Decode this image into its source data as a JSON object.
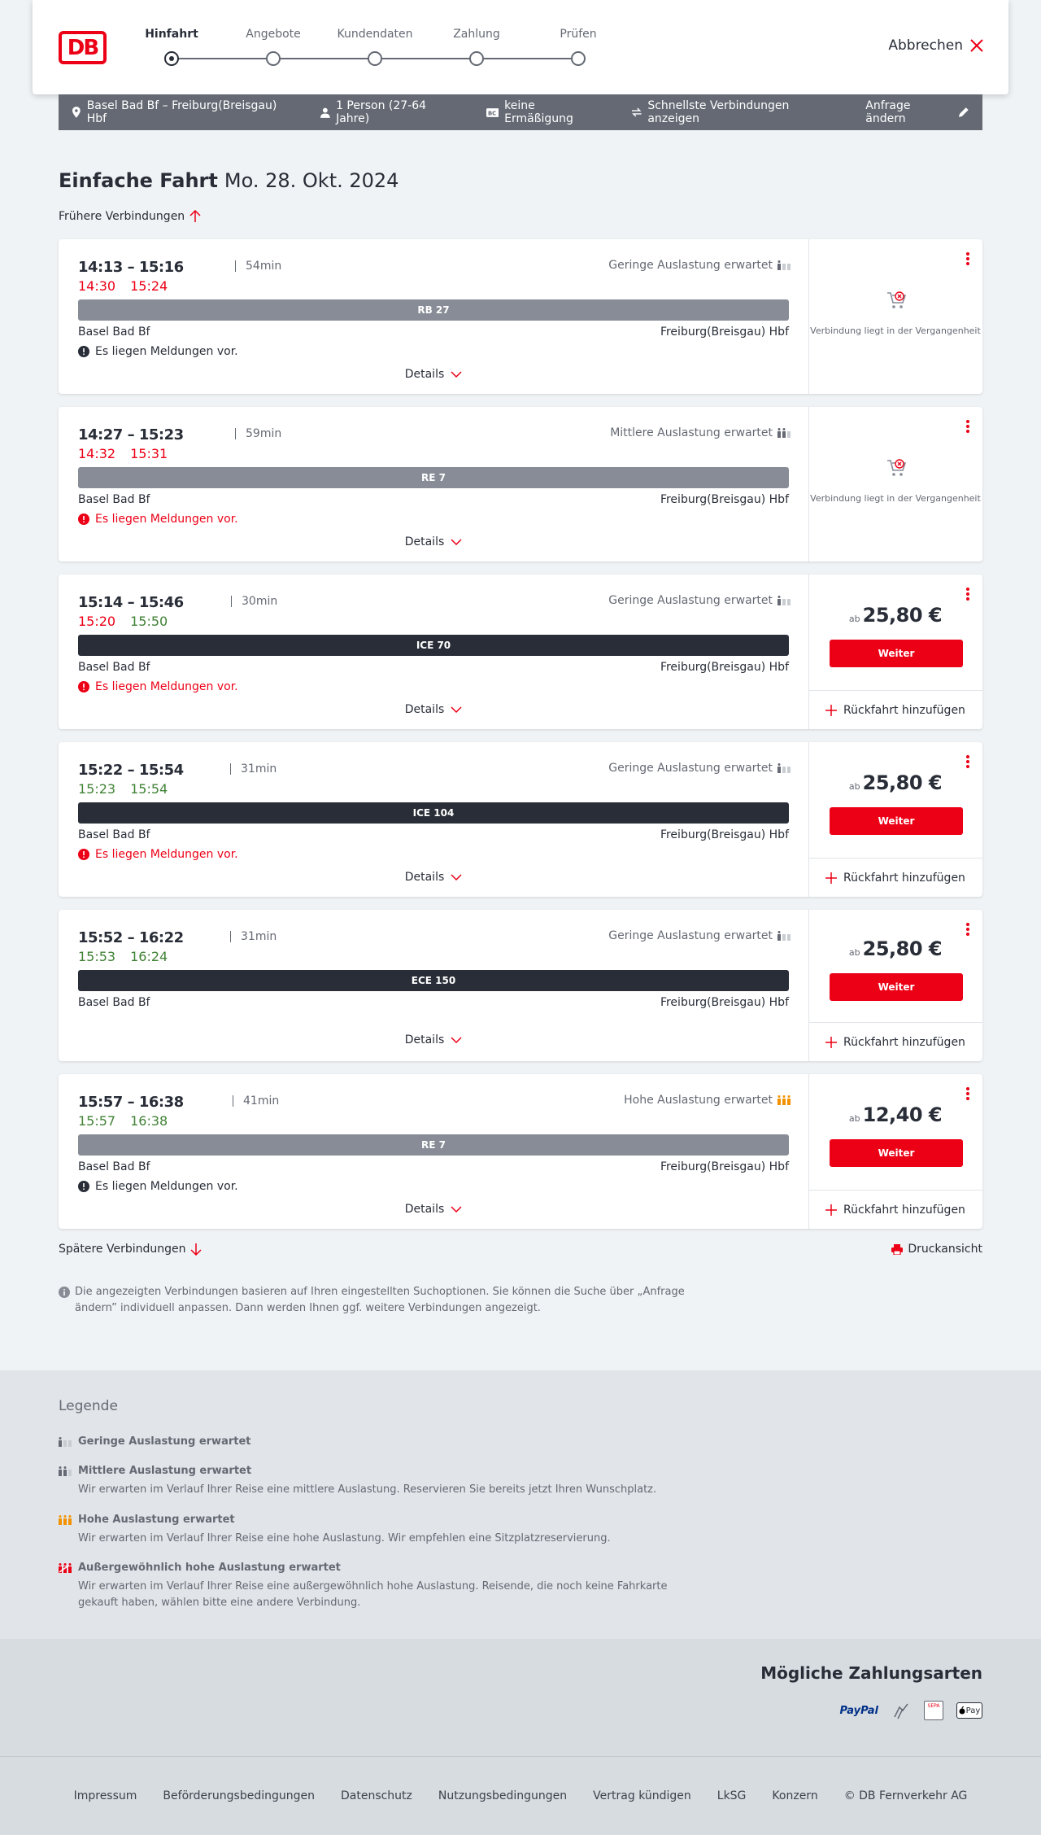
{
  "header": {
    "logo": "DB",
    "steps": [
      "Hinfahrt",
      "Angebote",
      "Kundendaten",
      "Zahlung",
      "Prüfen"
    ],
    "cancel": "Abbrechen"
  },
  "search": {
    "route": "Basel Bad Bf – Freiburg(Breisgau) Hbf",
    "persons": "1 Person (27-64 Jahre)",
    "discount": "keine Ermäßigung",
    "fastest": "Schnellste Verbindungen anzeigen",
    "change": "Anfrage ändern"
  },
  "page": {
    "title": "Einfache Fahrt",
    "date": "Mo. 28. Okt. 2024",
    "earlier": "Frühere Verbindungen",
    "later": "Spätere Verbindungen",
    "print": "Druckansicht",
    "info": "Die angezeigten Verbindungen basieren auf Ihren eingestellten Suchoptionen. Sie können die Suche über „Anfrage ändern” individuell anpassen. Dann werden Ihnen ggf. weitere Verbindungen angezeigt."
  },
  "labels": {
    "details": "Details",
    "from": "Basel Bad Bf",
    "to": "Freiburg(Breisgau) Hbf",
    "ab": "ab",
    "weiter": "Weiter",
    "return": "Rückfahrt hinzufügen",
    "past": "Verbindung liegt in der Vergangenheit"
  },
  "connections": [
    {
      "time": "14:13 – 15:16",
      "duration": "54min",
      "rt_dep": "14:30",
      "rt_arr": "15:24",
      "rt_dep_color": "red",
      "rt_arr_color": "red",
      "load": "Geringe Auslastung erwartet",
      "train": "RB 27",
      "train_color": "#878c96",
      "msg": "Es liegen Meldungen vor.",
      "msg_color": "#282d37",
      "price": ""
    },
    {
      "time": "14:27 – 15:23",
      "duration": "59min",
      "rt_dep": "14:32",
      "rt_arr": "15:31",
      "rt_dep_color": "red",
      "rt_arr_color": "red",
      "load": "Mittlere Auslastung erwartet",
      "train": "RE 7",
      "train_color": "#878c96",
      "msg": "Es liegen Meldungen vor.",
      "msg_color": "#ec0016",
      "price": ""
    },
    {
      "time": "15:14 – 15:46",
      "duration": "30min",
      "rt_dep": "15:20",
      "rt_arr": "15:50",
      "rt_dep_color": "red",
      "rt_arr_color": "green",
      "load": "Geringe Auslastung erwartet",
      "train": "ICE 70",
      "train_color": "#282d37",
      "msg": "Es liegen Meldungen vor.",
      "msg_color": "#ec0016",
      "price": "25,80 €"
    },
    {
      "time": "15:22 – 15:54",
      "duration": "31min",
      "rt_dep": "15:23",
      "rt_arr": "15:54",
      "rt_dep_color": "green",
      "rt_arr_color": "green",
      "load": "Geringe Auslastung erwartet",
      "train": "ICE 104",
      "train_color": "#282d37",
      "msg": "Es liegen Meldungen vor.",
      "msg_color": "#ec0016",
      "price": "25,80 €"
    },
    {
      "time": "15:52 – 16:22",
      "duration": "31min",
      "rt_dep": "15:53",
      "rt_arr": "16:24",
      "rt_dep_color": "green",
      "rt_arr_color": "green",
      "load": "Geringe Auslastung erwartet",
      "train": "ECE 150",
      "train_color": "#282d37",
      "msg": "",
      "msg_color": "",
      "price": "25,80 €"
    },
    {
      "time": "15:57 – 16:38",
      "duration": "41min",
      "rt_dep": "15:57",
      "rt_arr": "16:38",
      "rt_dep_color": "green",
      "rt_arr_color": "green",
      "load": "Hohe Auslastung erwartet",
      "train": "RE 7",
      "train_color": "#878c96",
      "msg": "Es liegen Meldungen vor.",
      "msg_color": "#282d37",
      "price": "12,40 €"
    }
  ],
  "legend": {
    "title": "Legende",
    "items": [
      {
        "title": "Geringe Auslastung erwartet",
        "desc": ""
      },
      {
        "title": "Mittlere Auslastung erwartet",
        "desc": "Wir erwarten im Verlauf Ihrer Reise eine mittlere Auslastung. Reservieren Sie bereits jetzt Ihren Wunschplatz."
      },
      {
        "title": "Hohe Auslastung erwartet",
        "desc": "Wir erwarten im Verlauf Ihrer Reise eine hohe Auslastung. Wir empfehlen eine Sitzplatzreservierung."
      },
      {
        "title": "Außergewöhnlich hohe Auslastung erwartet",
        "desc": "Wir erwarten im Verlauf Ihrer Reise eine außergewöhnlich hohe Auslastung. Reisende, die noch keine Fahrkarte gekauft haben, wählen bitte eine andere Verbindung."
      }
    ]
  },
  "payment": {
    "title": "Mögliche Zahlungsarten",
    "paypal": "PayPal",
    "applepay": "Pay",
    "sepa": "SEPA"
  },
  "footer": [
    "Impressum",
    "Beförderungsbedingungen",
    "Datenschutz",
    "Nutzungsbedingungen",
    "Vertrag kündigen",
    "LkSG",
    "Konzern",
    "© DB Fernverkehr AG"
  ]
}
